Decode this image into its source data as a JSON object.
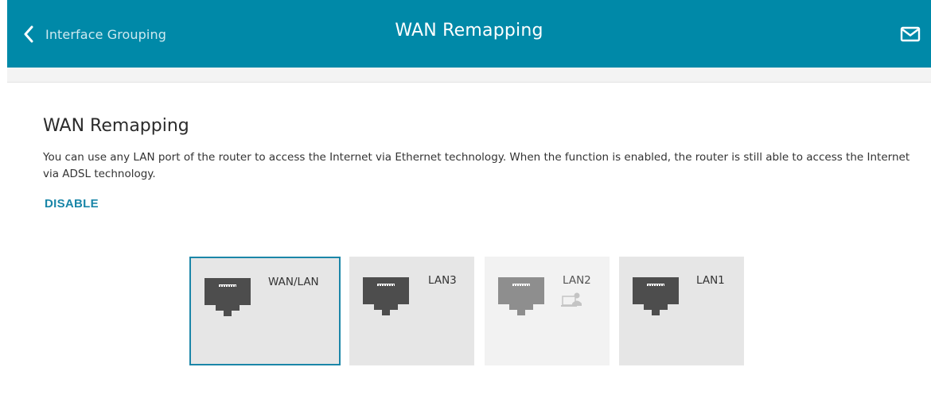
{
  "header": {
    "back_label": "Interface Grouping",
    "title": "WAN Remapping",
    "accent_color": "#0089a8",
    "back_icon": "chevron-left-icon",
    "mail_icon": "mail-icon"
  },
  "section": {
    "title": "WAN Remapping",
    "description": "You can use any LAN port of the router to access the Internet via Ethernet technology. When the function is enabled, the router is still able to access the Internet via ADSL technology.",
    "disable_label": "DISABLE"
  },
  "ports": [
    {
      "label": "WAN/LAN",
      "state": "selected",
      "icon": "ethernet-port-icon"
    },
    {
      "label": "LAN3",
      "state": "normal",
      "icon": "ethernet-port-icon"
    },
    {
      "label": "LAN2",
      "state": "disabled",
      "icon": "ethernet-port-icon",
      "extra_icon": "connected-client-icon"
    },
    {
      "label": "LAN1",
      "state": "normal",
      "icon": "ethernet-port-icon"
    }
  ]
}
